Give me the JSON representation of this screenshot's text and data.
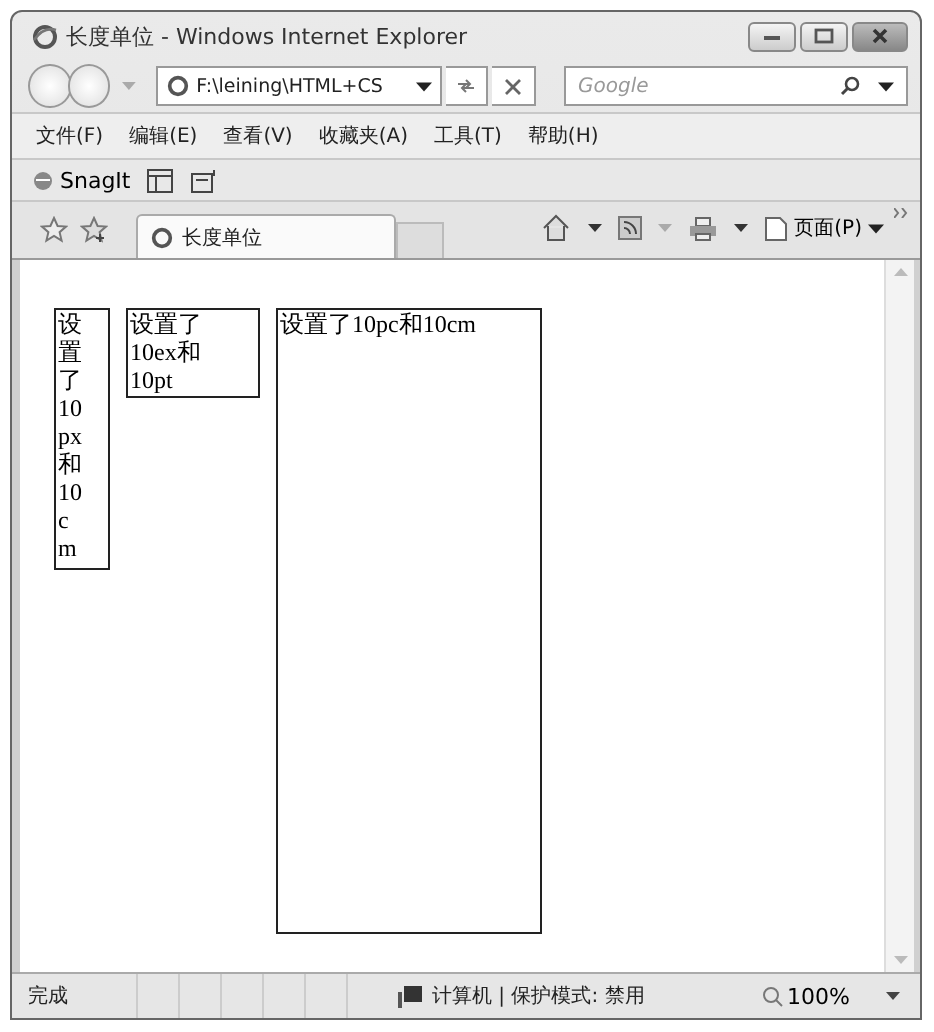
{
  "window": {
    "title": "长度单位 - Windows Internet Explorer"
  },
  "address_bar": {
    "value": "F:\\leining\\HTML+CS"
  },
  "search": {
    "placeholder": "Google"
  },
  "menu": [
    "文件(F)",
    "编辑(E)",
    "查看(V)",
    "收藏夹(A)",
    "工具(T)",
    "帮助(H)"
  ],
  "snagit_bar": {
    "label": "SnagIt"
  },
  "tabs": [
    {
      "label": "长度单位",
      "selected": true
    }
  ],
  "command_bar": {
    "page_menu": "页面(P)"
  },
  "boxes": [
    {
      "kind": "narrow",
      "text": "设置了10px和10cm"
    },
    {
      "kind": "medium",
      "text": "设置了10ex和10pt"
    },
    {
      "kind": "wide",
      "text": "设置了10pc和10cm"
    }
  ],
  "status_bar": {
    "status": "完成",
    "zone": "计算机 | 保护模式: 禁用",
    "zoom": "100%"
  }
}
